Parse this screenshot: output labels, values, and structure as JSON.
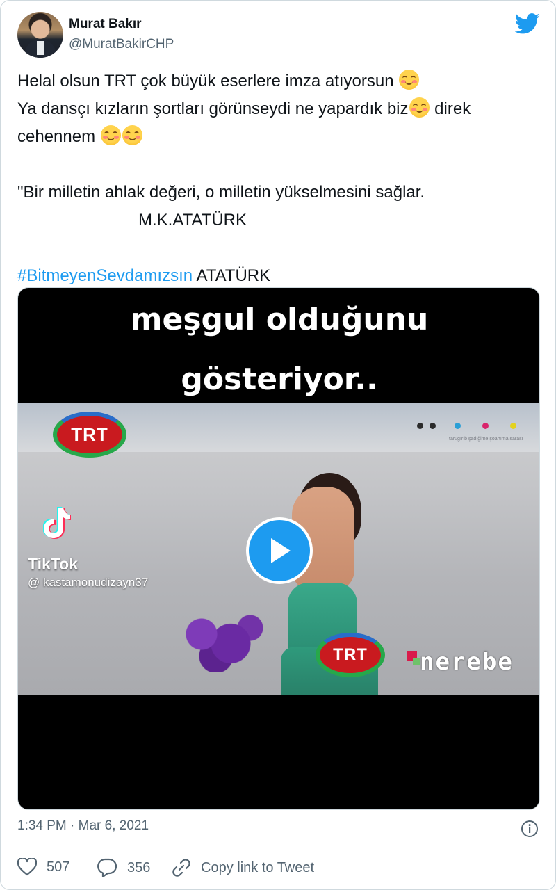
{
  "author": {
    "name": "Murat Bakır",
    "handle": "@MuratBakirCHP"
  },
  "tweet": {
    "line1": "Helal olsun TRT çok büyük eserlere imza atıyorsun",
    "line2a": "Ya dansçı kızların şortları görünseydi ne yapardık biz",
    "line2b": " direk",
    "line3": "cehennem",
    "quote": "\"Bir milletin ahlak değeri, o milletin yükselmesini sağlar.",
    "quote_author": "M.K.ATATÜRK",
    "hashtag": "#BitmeyenSevdamızsın",
    "hashtag_suffix": " ATATÜRK"
  },
  "media": {
    "caption_line1": "meşgul olduğunu",
    "caption_line2": "gösteriyor..",
    "trt_logo_text": "TRT",
    "tiktok_label": "TikTok",
    "tiktok_user": "@ kastamonudizayn37",
    "watermark": "nerebe",
    "dots_small_text": "tarugırıb şadığime şöartıma sarası",
    "play_icon": "play-icon"
  },
  "meta": {
    "timestamp": "1:34 PM · Mar 6, 2021"
  },
  "actions": {
    "likes": "507",
    "replies": "356",
    "copy_label": "Copy link to Tweet"
  },
  "colors": {
    "accent": "#1d9bf0",
    "text": "#0f1419",
    "muted": "#536471"
  }
}
